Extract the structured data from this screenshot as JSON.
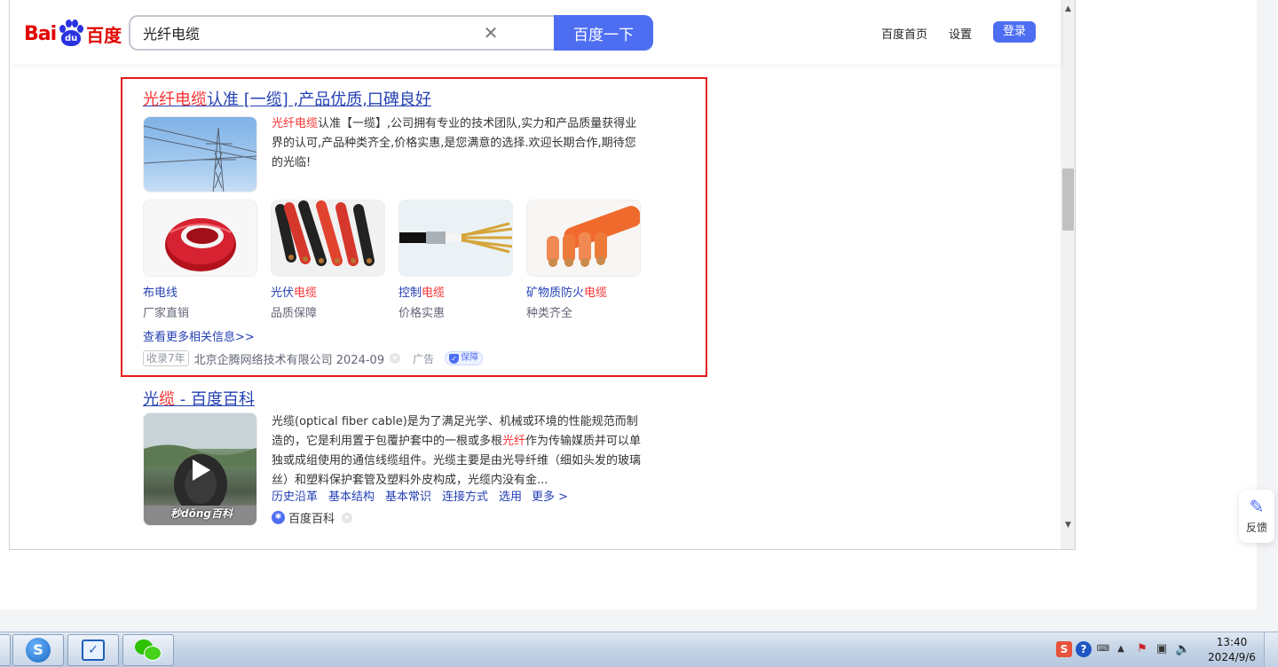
{
  "header": {
    "logo": "Bai du 百度",
    "search_value": "光纤电缆",
    "search_button": "百度一下",
    "links": [
      "百度首页",
      "设置"
    ],
    "login": "登录"
  },
  "ad_result": {
    "title_hl": "光纤电缆",
    "title_rest": "认准 [一缆] ,产品优质,口碑良好",
    "snippet_hl": "光纤电缆",
    "snippet_rest": "认准【一缆】,公司拥有专业的技术团队,实力和产品质量获得业界的认可,产品种类齐全,价格实惠,是您满意的选择.欢迎长期合作,期待您的光临!",
    "products": [
      {
        "title": "布电线",
        "title_hl": "",
        "sub": "厂家直销"
      },
      {
        "title": "光伏",
        "title_hl": "电缆",
        "sub": "品质保障"
      },
      {
        "title": "控制",
        "title_hl": "电缆",
        "sub": "价格实惠"
      },
      {
        "title": "矿物质防火",
        "title_hl": "电缆",
        "sub": "种类齐全"
      }
    ],
    "more_link": "查看更多相关信息>>",
    "footer": {
      "tag": "收录7年",
      "company": "北京企腾网络技术有限公司 2024-09",
      "ad_label": "广告",
      "badge": "保障"
    }
  },
  "baike_result": {
    "title_a": "光",
    "title_hl": "缆",
    "title_b": " - 百度百科",
    "snippet_a": "光缆(optical fiber cable)是为了满足光学、机械或环境的性能规范而制造的，它是利用置于包覆护套中的一根或多根",
    "snippet_hl": "光纤",
    "snippet_b": "作为传输媒质并可以单独或成组使用的通信线缆组件。光缆主要是由光导纤维（细如头发的玻璃丝）和塑料保护套管及塑料外皮构成，光缆内没有金...",
    "links": [
      "历史沿革",
      "基本结构",
      "基本常识",
      "连接方式",
      "选用",
      "更多 >"
    ],
    "source": "百度百科",
    "video_watermark": "秒dǒng百科"
  },
  "feedback": "反馈",
  "taskbar": {
    "time": "13:40",
    "date": "2024/9/6"
  },
  "colors": {
    "accent": "#4e6ef2",
    "link": "#2440b3",
    "highlight": "#f73131",
    "ad_border": "#e81a1a"
  }
}
